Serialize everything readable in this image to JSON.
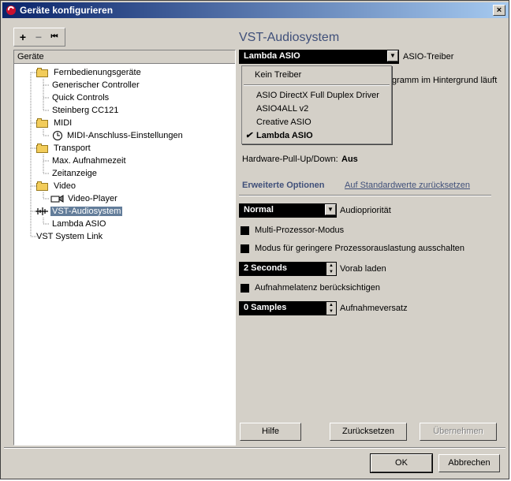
{
  "window": {
    "title": "Geräte konfigurieren"
  },
  "toolbar": {
    "add": "+",
    "remove": "−",
    "reset": "⏮"
  },
  "tree": {
    "header": "Geräte",
    "items": [
      {
        "label": "Fernbedienungsgeräte",
        "icon": "folder-icon"
      },
      {
        "label": "Generischer Controller"
      },
      {
        "label": "Quick Controls"
      },
      {
        "label": "Steinberg CC121"
      },
      {
        "label": "MIDI",
        "icon": "folder-icon"
      },
      {
        "label": "MIDI-Anschluss-Einstellungen",
        "icon": "clock-icon"
      },
      {
        "label": "Transport",
        "icon": "folder-icon"
      },
      {
        "label": "Max. Aufnahmezeit"
      },
      {
        "label": "Zeitanzeige"
      },
      {
        "label": "Video",
        "icon": "folder-icon"
      },
      {
        "label": "Video-Player",
        "icon": "video-icon"
      },
      {
        "label": "VST-Audiosystem",
        "icon": "audio-icon"
      },
      {
        "label": "Lambda ASIO"
      },
      {
        "label": "VST System Link"
      }
    ]
  },
  "right": {
    "heading": "VST-Audiosystem",
    "driver": {
      "value": "Lambda ASIO",
      "label": "ASIO-Treiber"
    },
    "background_label_partial": "gramm im Hintergrund läuft",
    "dropdown": [
      {
        "label": "Kein Treiber"
      },
      {
        "label": "ASIO DirectX Full Duplex Driver"
      },
      {
        "label": "ASIO4ALL v2"
      },
      {
        "label": "Creative ASIO"
      },
      {
        "label": "Lambda ASIO",
        "checked": true
      }
    ],
    "hardware_pull": {
      "label": "Hardware-Pull-Up/Down:",
      "value": "Aus"
    },
    "tab_advanced": "Erweiterte Optionen",
    "link_reset": "Auf Standardwerte zurücksetzen",
    "priority": {
      "value": "Normal",
      "label": "Audiopriorität"
    },
    "multi_processor": "Multi-Prozessor-Modus",
    "low_load": "Modus für geringere Prozessorauslastung ausschalten",
    "preload": {
      "value": "2 Seconds",
      "label": "Vorab laden"
    },
    "latency": "Aufnahmelatenz berücksichtigen",
    "offset": {
      "value": "0 Samples",
      "label": "Aufnahmeversatz"
    },
    "buttons": {
      "help": "Hilfe",
      "reset": "Zurücksetzen",
      "apply": "Übernehmen"
    }
  },
  "footer": {
    "ok": "OK",
    "cancel": "Abbrechen"
  },
  "colors": {
    "titlebar_start": "#0a246a",
    "titlebar_end": "#a6caf0",
    "selection": "#637d9a",
    "heading": "#40507a",
    "link": "#40507a"
  }
}
